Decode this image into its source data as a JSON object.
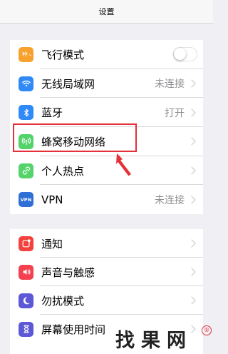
{
  "nav": {
    "title": "设置"
  },
  "group1": [
    {
      "label": "飞行模式",
      "icon": "airplane-icon",
      "color": "#f7a12f",
      "toggle": false
    },
    {
      "label": "无线局域网",
      "icon": "wifi-icon",
      "color": "#2f8af7",
      "value": "未连接"
    },
    {
      "label": "蓝牙",
      "icon": "bluetooth-icon",
      "color": "#2f8af7",
      "value": "打开"
    },
    {
      "label": "蜂窝移动网络",
      "icon": "cellular-icon",
      "color": "#53d36a"
    },
    {
      "label": "个人热点",
      "icon": "hotspot-icon",
      "color": "#53d36a"
    },
    {
      "label": "VPN",
      "icon": "vpn-icon",
      "color": "#2f6fd6",
      "value": "未连接"
    }
  ],
  "group2": [
    {
      "label": "通知",
      "icon": "notification-icon",
      "color": "#f3413c"
    },
    {
      "label": "声音与触感",
      "icon": "sound-icon",
      "color": "#f3414f"
    },
    {
      "label": "勿扰模式",
      "icon": "moon-icon",
      "color": "#5d58d6"
    },
    {
      "label": "屏幕使用时间",
      "icon": "hourglass-icon",
      "color": "#5d58d6"
    }
  ],
  "icons": {
    "vpn_text": "VPN"
  },
  "highlight_color": "#e5303a",
  "watermark": {
    "text": "找果网",
    "badge": "®"
  }
}
